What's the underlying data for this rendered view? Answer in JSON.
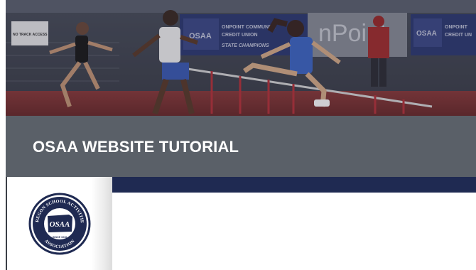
{
  "slide": {
    "title": "OSAA WEBSITE TUTORIAL"
  },
  "photo": {
    "sponsor_banner_1": {
      "brand": "OSAA",
      "line1": "ONPOINT COMMUNITY",
      "line2": "CREDIT UNION",
      "line3": "STATE CHAMPIONS"
    },
    "sponsor_banner_2": {
      "brand_partial": "nPoint"
    },
    "sponsor_banner_3": {
      "brand": "OSAA",
      "line1": "ONPOINT",
      "line2": "CREDIT UN"
    },
    "sign_text": "NO TRACK ACCESS"
  },
  "logo": {
    "arc_top": "OREGON SCHOOL ACTIVITIES",
    "arc_bottom": "ASSOCIATION",
    "center": "OSAA",
    "since": "SINCE 1918"
  },
  "colors": {
    "title_band": "#5a6068",
    "navy_strip": "#1f2a52",
    "logo_navy": "#1f2a52"
  }
}
